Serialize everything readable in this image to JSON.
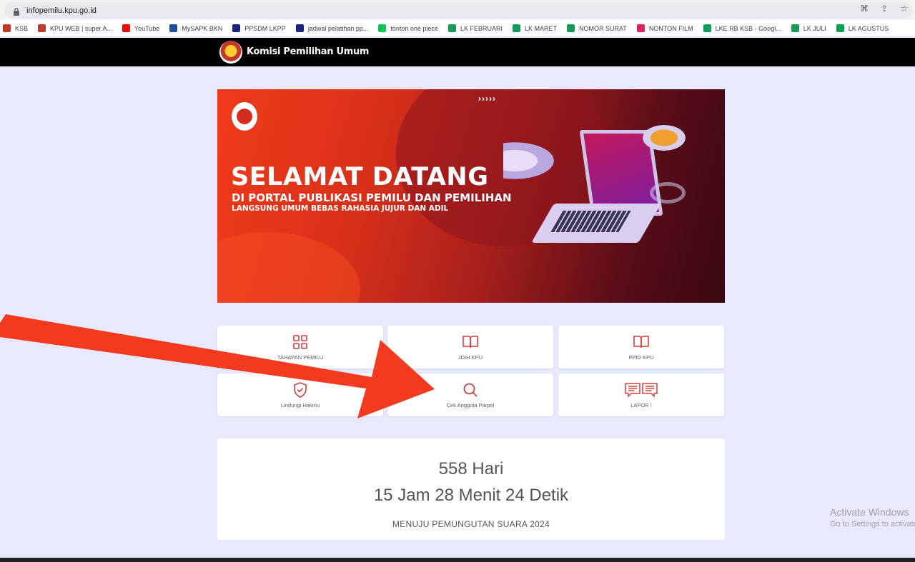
{
  "browser": {
    "url": "infopemilu.kpu.go.id",
    "bookmarks": [
      {
        "label": "KSB",
        "icon": "kpu-icon",
        "color": "#c0392b"
      },
      {
        "label": "KPU WEB | super A...",
        "icon": "kpu-icon",
        "color": "#c0392b"
      },
      {
        "label": "YouTube",
        "icon": "youtube-icon",
        "color": "#ff0000"
      },
      {
        "label": "MySAPK BKN",
        "icon": "bkn-icon",
        "color": "#1a4fa0"
      },
      {
        "label": "PPSDM LKPP",
        "icon": "lkpp-icon",
        "color": "#1a237e"
      },
      {
        "label": "jadwal pelatihan pp...",
        "icon": "lkpp-icon",
        "color": "#1a237e"
      },
      {
        "label": "tonton one piece",
        "icon": "iqiyi-icon",
        "color": "#00c853"
      },
      {
        "label": "LK FEBRUARI",
        "icon": "sheets-icon",
        "color": "#0f9d58"
      },
      {
        "label": "LK MARET",
        "icon": "sheets-icon",
        "color": "#0f9d58"
      },
      {
        "label": "NOMOR SURAT",
        "icon": "sheets-icon",
        "color": "#0f9d58"
      },
      {
        "label": "NONTON FILM",
        "icon": "film-icon",
        "color": "#e91e63"
      },
      {
        "label": "LKE RB KSB - Googl...",
        "icon": "sheets-icon",
        "color": "#0f9d58"
      },
      {
        "label": "LK JULI",
        "icon": "sheets-icon",
        "color": "#0f9d58"
      },
      {
        "label": "LK AGUSTUS",
        "icon": "sheets-icon",
        "color": "#0f9d58"
      }
    ]
  },
  "header": {
    "brand": "Komisi Pemilihan Umum"
  },
  "banner": {
    "title": "SELAMAT DATANG",
    "subtitle1": "DI PORTAL PUBLIKASI PEMILU DAN PEMILIHAN",
    "subtitle2": "LANGSUNG UMUM BEBAS RAHASIA JUJUR DAN ADIL",
    "chevrons": "›››››"
  },
  "tiles": [
    {
      "label": "TAHAPAN PEMILU",
      "icon": "grid-icon"
    },
    {
      "label": "JDIH KPU",
      "icon": "book-icon"
    },
    {
      "label": "PPID KPU",
      "icon": "book-icon"
    },
    {
      "label": "Lindungi Hakmu",
      "icon": "shield-check-icon"
    },
    {
      "label": "Cek Anggota Parpol",
      "icon": "search-icon"
    },
    {
      "label": "LAPOR !",
      "icon": "chat-icon"
    }
  ],
  "countdown": {
    "days": "558 Hari",
    "time": "15 Jam 28 Menit 24 Detik",
    "caption": "MENUJU PEMUNGUTAN SUARA 2024"
  },
  "watermark": {
    "line1": "Activate Windows",
    "line2": "Go to Settings to activate Windows."
  },
  "colors": {
    "accent": "#d83b3b",
    "page_bg": "#e8e8ff",
    "arrow": "#f23a1f"
  }
}
